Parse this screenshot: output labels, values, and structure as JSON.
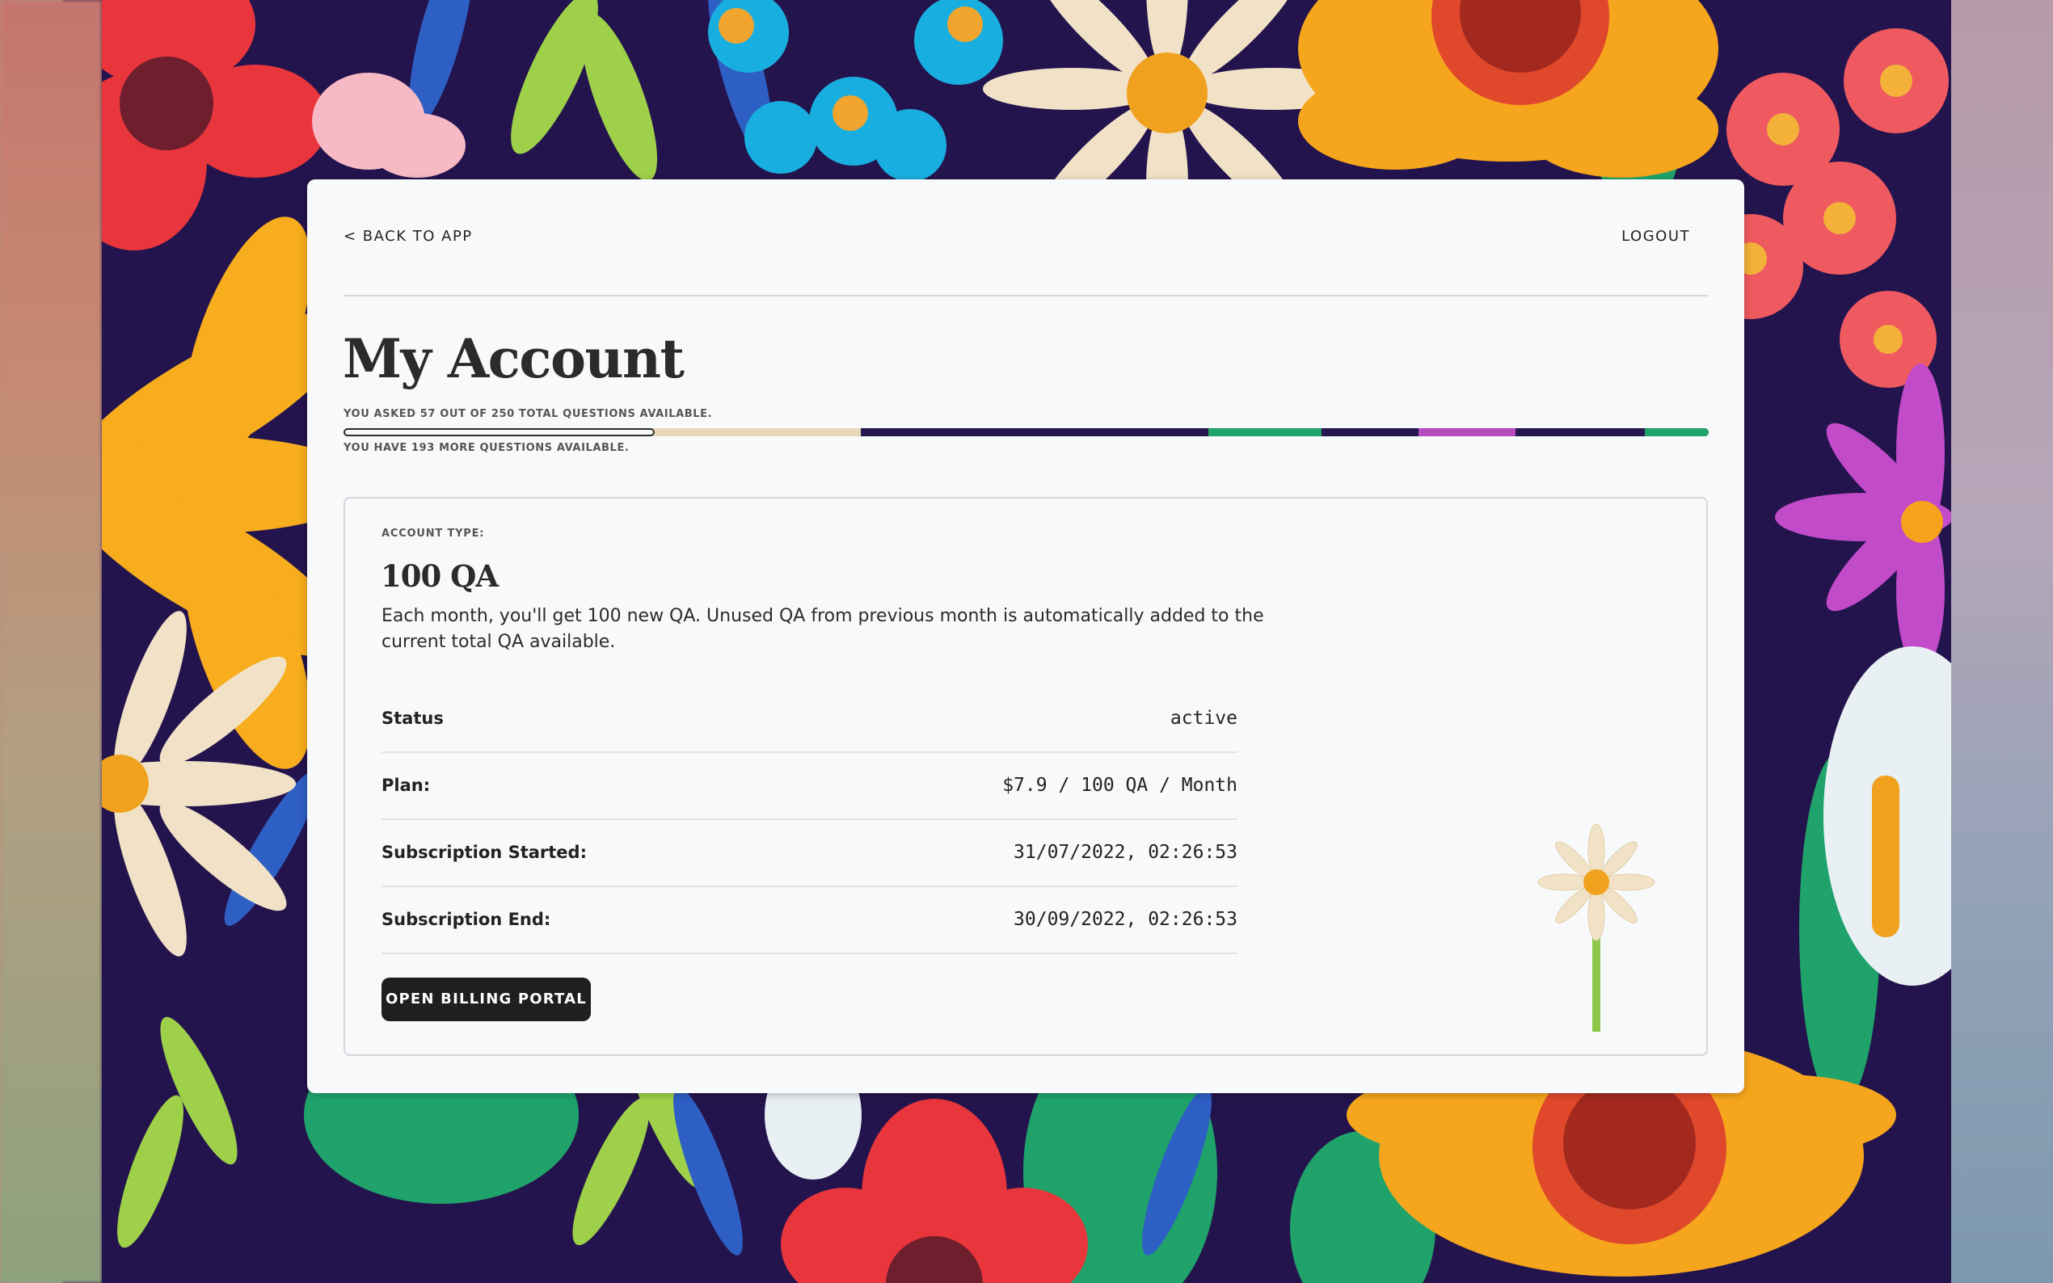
{
  "nav": {
    "back_label": "< BACK TO APP",
    "logout_label": "LOGOUT"
  },
  "page": {
    "title": "My Account"
  },
  "usage": {
    "asked_text": "YOU ASKED 57 OUT OF 250 TOTAL QUESTIONS AVAILABLE.",
    "remaining_text": "YOU HAVE 193 MORE QUESTIONS AVAILABLE.",
    "used": 57,
    "total": 250
  },
  "account": {
    "type_label": "ACCOUNT TYPE:",
    "type_name": "100 QA",
    "description": "Each month, you'll get 100 new QA. Unused QA from previous month is automatically added to the current total QA available.",
    "details": [
      {
        "key": "Status",
        "value": "active"
      },
      {
        "key": "Plan:",
        "value": "$7.9 / 100 QA / Month"
      },
      {
        "key": "Subscription Started:",
        "value": "31/07/2022, 02:26:53"
      },
      {
        "key": "Subscription End:",
        "value": "30/09/2022, 02:26:53"
      }
    ],
    "billing_button": "OPEN BILLING PORTAL"
  },
  "icons": {
    "decoration": "daisy-flower-icon",
    "background": "floral-pattern"
  },
  "colors": {
    "button_bg": "#1f1f1f",
    "card_bg": "#f7f9fb",
    "wall_bg": "#24144d"
  }
}
